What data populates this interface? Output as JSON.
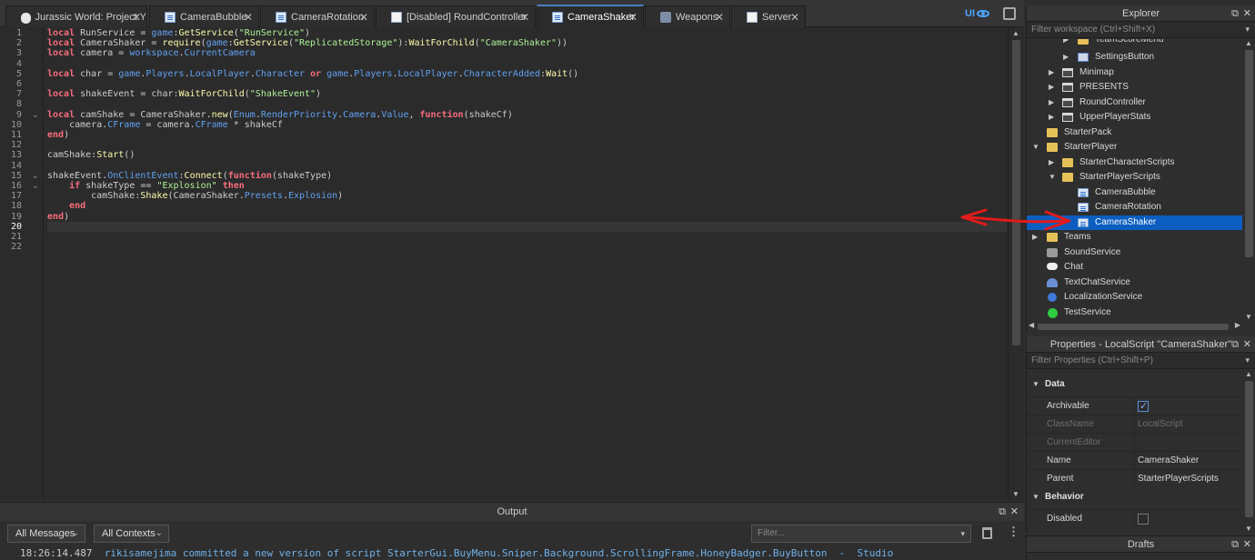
{
  "tabs": [
    {
      "label": "Jurassic World: Project Y",
      "icon": "cloud-icon",
      "active": false
    },
    {
      "label": "CameraBubble",
      "icon": "script-icon",
      "active": false
    },
    {
      "label": "CameraRotation",
      "icon": "script-icon",
      "active": false
    },
    {
      "label": "[Disabled] RoundController",
      "icon": "document-icon",
      "active": false
    },
    {
      "label": "CameraShaker",
      "icon": "script-icon",
      "active": true
    },
    {
      "label": "Weapons",
      "icon": "tools-icon",
      "active": false
    },
    {
      "label": "Server",
      "icon": "document-icon",
      "active": false
    }
  ],
  "toolbar": {
    "ui_label": "UI",
    "close_glyph": "✕"
  },
  "editor": {
    "current_line": 20,
    "line_numbers": [
      "1",
      "2",
      "3",
      "4",
      "5",
      "6",
      "7",
      "8",
      "9",
      "10",
      "11",
      "12",
      "13",
      "14",
      "15",
      "16",
      "17",
      "18",
      "19",
      "20",
      "21",
      "22"
    ],
    "fold_markers": [
      "⌄",
      "⌄",
      "⌄"
    ]
  },
  "output": {
    "title": "Output",
    "messages_filter": "All Messages",
    "contexts_filter": "All Contexts",
    "filter_placeholder": "Filter...",
    "log_time": "18:26:14.487",
    "log_message": "rikisamejima committed a new version of script StarterGui.BuyMenu.Sniper.Background.ScrollingFrame.HoneyBadger.BuyButton  -  Studio"
  },
  "explorer": {
    "title": "Explorer",
    "filter_placeholder": "Filter workspace (Ctrl+Shift+X)",
    "items": [
      {
        "label": "TeamScoreMenu",
        "icon": "folder-icon"
      },
      {
        "label": "SettingsButton",
        "icon": "image-button-icon"
      },
      {
        "label": "Minimap",
        "icon": "frame-icon"
      },
      {
        "label": "PRESENTS",
        "icon": "frame-icon"
      },
      {
        "label": "RoundController",
        "icon": "frame-icon"
      },
      {
        "label": "UpperPlayerStats",
        "icon": "frame-icon"
      },
      {
        "label": "StarterPack",
        "icon": "folder-icon"
      },
      {
        "label": "StarterPlayer",
        "icon": "folder-icon"
      },
      {
        "label": "StarterCharacterScripts",
        "icon": "folder-icon"
      },
      {
        "label": "StarterPlayerScripts",
        "icon": "folder-icon"
      },
      {
        "label": "CameraBubble",
        "icon": "script-icon"
      },
      {
        "label": "CameraRotation",
        "icon": "script-icon"
      },
      {
        "label": "CameraShaker",
        "icon": "script-icon",
        "selected": true
      },
      {
        "label": "Teams",
        "icon": "folder-icon"
      },
      {
        "label": "SoundService",
        "icon": "sound-icon"
      },
      {
        "label": "Chat",
        "icon": "chat-icon"
      },
      {
        "label": "TextChatService",
        "icon": "people-icon"
      },
      {
        "label": "LocalizationService",
        "icon": "globe-icon"
      },
      {
        "label": "TestService",
        "icon": "check-icon"
      }
    ]
  },
  "properties": {
    "title": "Properties - LocalScript \"CameraShaker\"",
    "filter_placeholder": "Filter Properties (Ctrl+Shift+P)",
    "categories": [
      "Data",
      "Behavior"
    ],
    "rows": [
      {
        "name": "Archivable",
        "value": "",
        "checked": true
      },
      {
        "name": "ClassName",
        "value": "LocalScript"
      },
      {
        "name": "CurrentEditor",
        "value": ""
      },
      {
        "name": "Name",
        "value": "CameraShaker"
      },
      {
        "name": "Parent",
        "value": "StarterPlayerScripts"
      },
      {
        "name": "Disabled",
        "value": "",
        "checked": false
      }
    ]
  },
  "drafts": {
    "title": "Drafts"
  },
  "colors": {
    "selection": "#0b5ec0",
    "keyword": "#f86d7c",
    "string": "#adf195",
    "method": "#fdfbac",
    "property": "#61a1f1",
    "annotation": "#e01b1b"
  }
}
